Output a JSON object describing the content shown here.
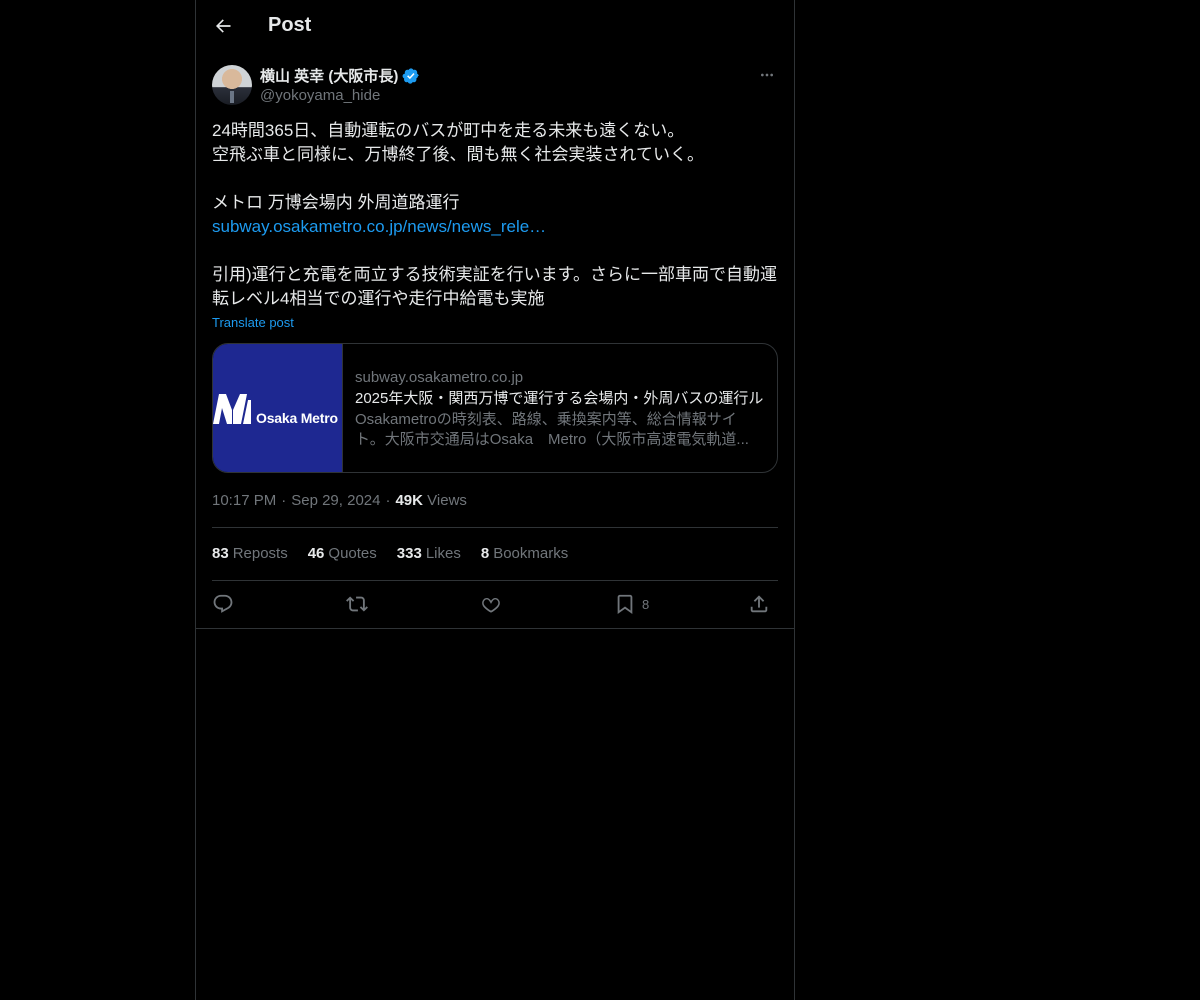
{
  "header": {
    "title": "Post"
  },
  "author": {
    "name": "横山 英幸 (大阪市長)",
    "handle": "@yokoyama_hide"
  },
  "post": {
    "lines": [
      "24時間365日、自動運転のバスが町中を走る未来も遠くない。",
      "空飛ぶ車と同様に、万博終了後、間も無く社会実装されていく。",
      "",
      "メトロ 万博会場内 外周道路運行"
    ],
    "link_text": "subway.osakametro.co.jp/news/news_rele…",
    "quote_lines": [
      "引用)運行と充電を両立する技術実証を行います。さらに一部車両で自動運",
      "転レベル4相当での運行や走行中給電も実施"
    ],
    "translate_label": "Translate post"
  },
  "card": {
    "logo_text": "Osaka Metro",
    "domain": "subway.osakametro.co.jp",
    "title": "2025年大阪・関西万博で運行する会場内・外周バスの運行ル",
    "description": "Osakametroの時刻表、路線、乗換案内等、総合情報サイト。大阪市交通局はOsaka　Metro（大阪市高速電気軌道..."
  },
  "meta": {
    "time": "10:17 PM",
    "date": "Sep 29, 2024",
    "views_count": "49K",
    "views_label": "Views",
    "separator": "·"
  },
  "stats": {
    "reposts_count": "83",
    "reposts_label": "Reposts",
    "quotes_count": "46",
    "quotes_label": "Quotes",
    "likes_count": "333",
    "likes_label": "Likes",
    "bookmarks_count": "8",
    "bookmarks_label": "Bookmarks"
  },
  "actions": {
    "reply_icon": "reply-icon",
    "repost_icon": "repost-icon",
    "like_icon": "heart-icon",
    "bookmark_icon": "bookmark-icon",
    "bookmark_count": "8",
    "share_icon": "share-icon"
  },
  "colors": {
    "background": "#000000",
    "text": "#e7e9ea",
    "secondary": "#71767b",
    "accent": "#1d9bf0",
    "border": "#2f3336",
    "card_brand": "#1e2891"
  }
}
